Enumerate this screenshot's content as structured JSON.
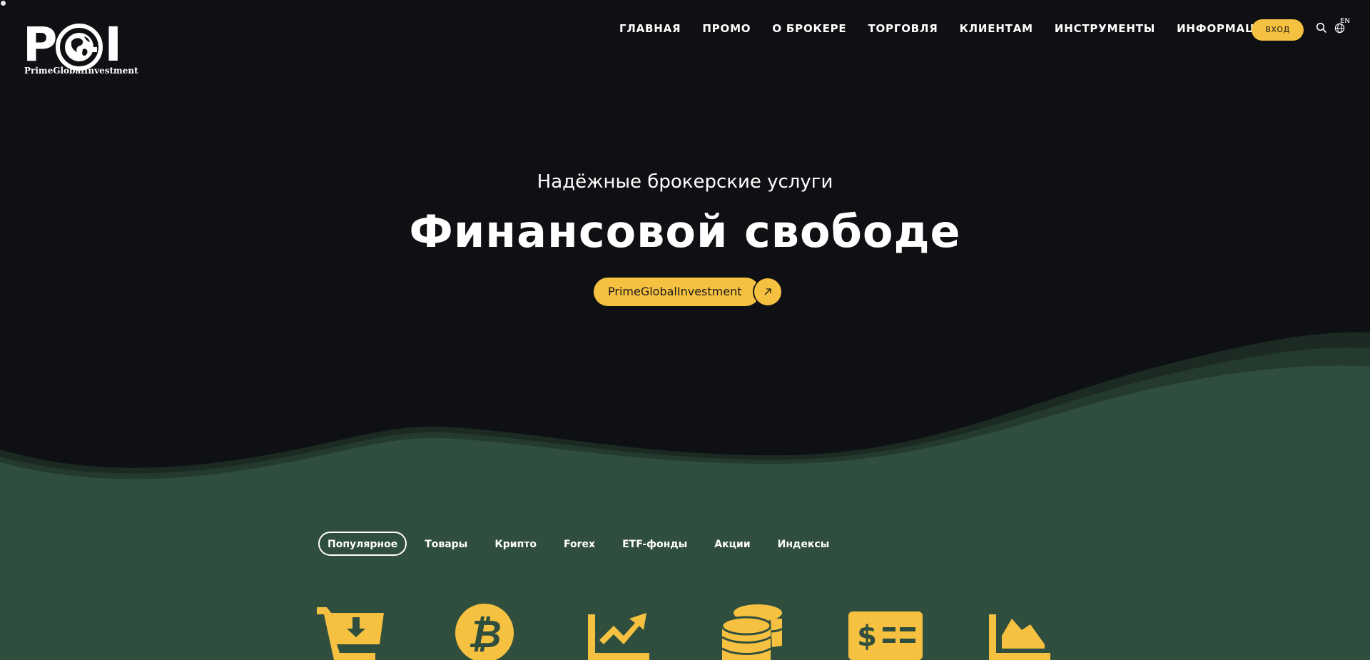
{
  "brand": {
    "logo_letters": "PGI",
    "logo_name": "PrimeGlobalInvestment"
  },
  "nav": {
    "items": [
      {
        "label": "ГЛАВНАЯ"
      },
      {
        "label": "ПРОМО"
      },
      {
        "label": "О БРОКЕРЕ"
      },
      {
        "label": "ТОРГОВЛЯ"
      },
      {
        "label": "КЛИЕНТАМ"
      },
      {
        "label": "ИНСТРУМЕНТЫ"
      },
      {
        "label": "ИНФОРМАЦИЯ"
      }
    ],
    "login_label": "ВХОД",
    "language": "EN",
    "search_icon": "search-icon",
    "language_icon": "globe-icon"
  },
  "hero": {
    "subtitle": "Надёжные брокерские услуги",
    "title": "Финансовой свободе",
    "cta_label": "PrimeGlobalInvestment",
    "cta_icon": "arrow-up-right-icon"
  },
  "tabs": [
    {
      "label": "Популярное",
      "active": true
    },
    {
      "label": "Товары",
      "active": false
    },
    {
      "label": "Крипто",
      "active": false
    },
    {
      "label": "Forex",
      "active": false
    },
    {
      "label": "ETF-фонды",
      "active": false
    },
    {
      "label": "Акции",
      "active": false
    },
    {
      "label": "Индексы",
      "active": false
    }
  ],
  "category_icons": [
    "cart-download-icon",
    "bitcoin-icon",
    "trend-chart-icon",
    "coins-stack-icon",
    "dollar-check-icon",
    "area-chart-icon"
  ],
  "colors": {
    "background": "#0e1013",
    "accent": "#f6c141",
    "wave_green": "#304e3d",
    "wave_dark": "#1f3328"
  }
}
